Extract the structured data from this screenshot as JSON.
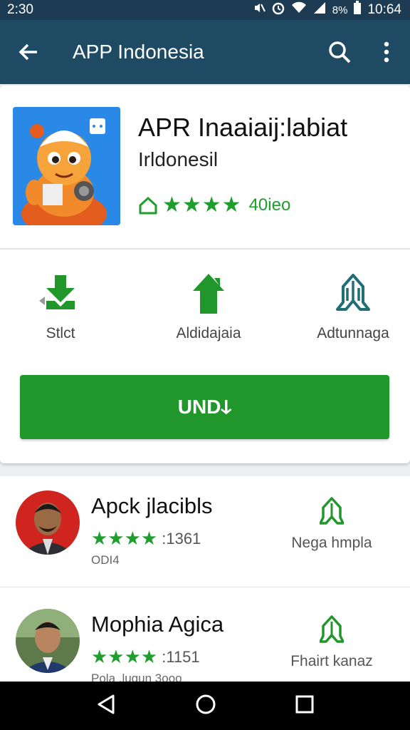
{
  "status_bar": {
    "time": "2:30",
    "battery_text": "8%",
    "clock_right": "10:64"
  },
  "app_bar": {
    "title": "APP Indonesia"
  },
  "app": {
    "name": "APR Inaaiaij:labiat",
    "developer": "Irldonesil",
    "stars": "★★★★",
    "rating_count": "40ieo"
  },
  "actions": [
    {
      "label": "Stlct",
      "icon": "download-icon"
    },
    {
      "label": "Aldidajaia",
      "icon": "home-arrow-icon"
    },
    {
      "label": "Adtunnaga",
      "icon": "share-icon"
    }
  ],
  "install_button": {
    "label": "UNDↆ"
  },
  "list": [
    {
      "name": "Apck jlacibls",
      "stars": "★★★★",
      "rating": ":1361",
      "sub": "ODI4",
      "right_label": "Nega hmpla"
    },
    {
      "name": "Mophia Agica",
      "stars": "★★★★",
      "rating": ":1151",
      "sub": "Pola .lugun 3ooo",
      "right_label": "Fhairt kanaz"
    }
  ],
  "colors": {
    "app_bar": "#1f4a63",
    "status_bar": "#1d3b53",
    "accent_green": "#21962b",
    "teal_icon": "#1f6f74"
  }
}
